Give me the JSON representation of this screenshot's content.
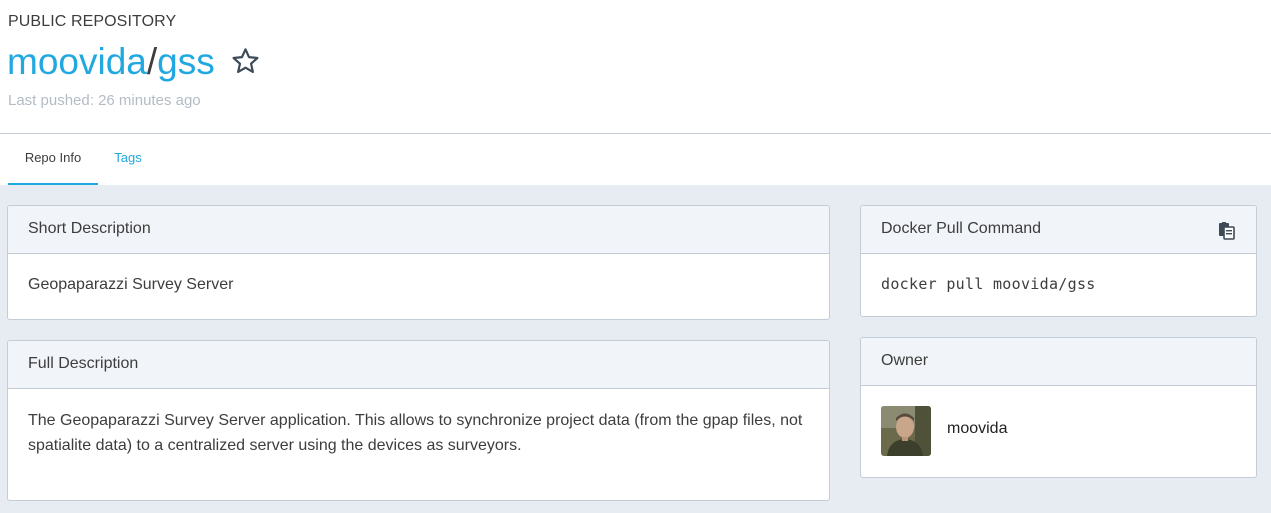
{
  "header": {
    "kind": "PUBLIC REPOSITORY",
    "namespace": "moovida",
    "slash": "/",
    "repo_name": "gss",
    "last_pushed": "Last pushed: 26 minutes ago"
  },
  "tabs": [
    {
      "label": "Repo Info",
      "active": true
    },
    {
      "label": "Tags",
      "active": false
    }
  ],
  "short_description": {
    "title": "Short Description",
    "text": "Geopaparazzi Survey Server"
  },
  "full_description": {
    "title": "Full Description",
    "text": "The Geopaparazzi Survey Server application. This allows to synchronize project data (from the gpap files, not spatialite data) to a centralized server using the devices as surveyors."
  },
  "pull_command": {
    "title": "Docker Pull Command",
    "command": "docker pull moovida/gss",
    "icon": "clipboard-icon"
  },
  "owner": {
    "title": "Owner",
    "name": "moovida"
  },
  "colors": {
    "accent": "#22a8e0",
    "content_bg": "#e7ecf3",
    "panel_head_bg": "#f1f4f8",
    "border": "#c4cdd5",
    "muted_text": "#b3bcc5"
  }
}
